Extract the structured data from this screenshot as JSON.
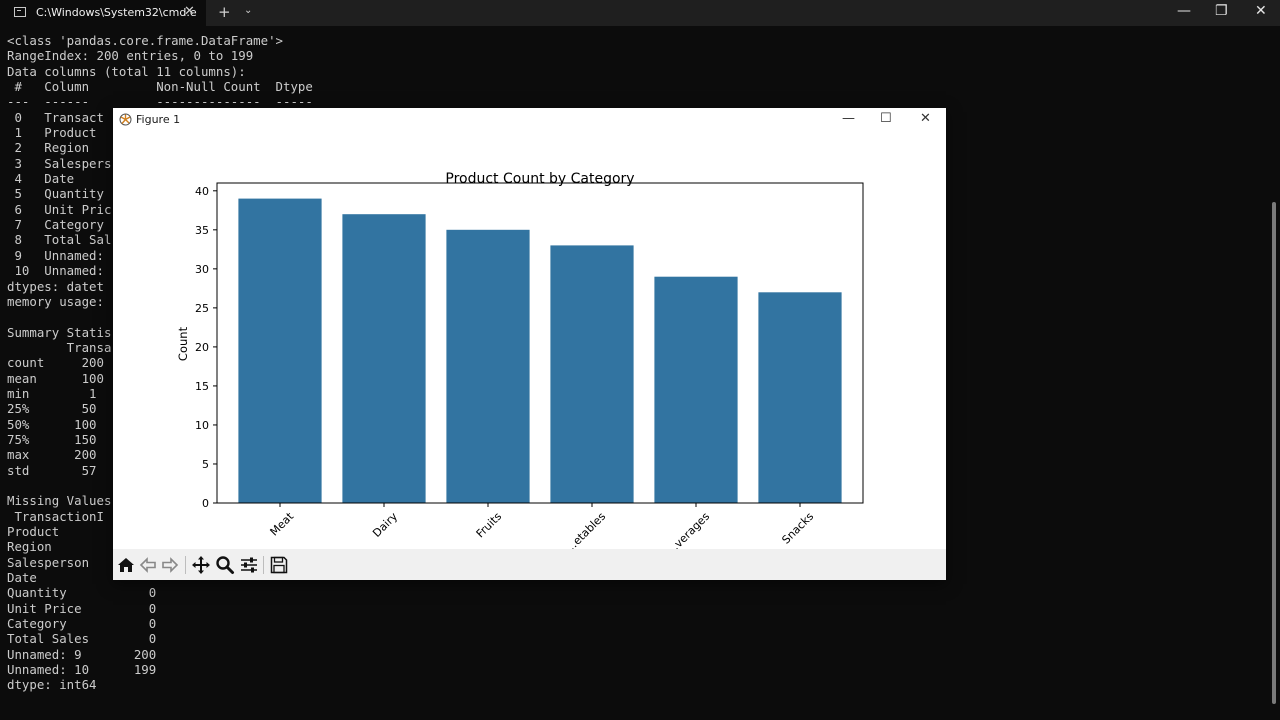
{
  "terminal": {
    "tab_title": "C:\\Windows\\System32\\cmd.e",
    "new_tab": "+",
    "lines": [
      "<class 'pandas.core.frame.DataFrame'>",
      "RangeIndex: 200 entries, 0 to 199",
      "Data columns (total 11 columns):",
      " #   Column         Non-Null Count  Dtype",
      "---  ------         --------------  -----",
      " 0   Transact",
      " 1   Product",
      " 2   Region",
      " 3   Salespers",
      " 4   Date",
      " 5   Quantity",
      " 6   Unit Pric",
      " 7   Category",
      " 8   Total Sal",
      " 9   Unnamed:",
      " 10  Unnamed:",
      "dtypes: datet",
      "memory usage:",
      "",
      "Summary Statis",
      "        Transa",
      "count     200",
      "mean      100",
      "min        1",
      "25%       50",
      "50%      100",
      "75%      150",
      "max      200",
      "std       57",
      "",
      "Missing Values",
      " TransactionI",
      "Product",
      "Region",
      "Salesperson",
      "Date",
      "Quantity           0",
      "Unit Price         0",
      "Category           0",
      "Total Sales        0",
      "Unnamed: 9       200",
      "Unnamed: 10      199",
      "dtype: int64"
    ]
  },
  "figure": {
    "window_title": "Figure 1",
    "toolbar": [
      "home-icon",
      "back-icon",
      "forward-icon",
      "pan-icon",
      "zoom-icon",
      "configure-icon",
      "save-icon"
    ]
  },
  "chart_data": {
    "type": "bar",
    "title": "Product Count by Category",
    "xlabel": "",
    "ylabel": "Count",
    "categories": [
      "Meat",
      "Dairy",
      "Fruits",
      "Vegetables",
      "Beverages",
      "Snacks"
    ],
    "category_labels_visible": [
      "Meat",
      "Dairy",
      "Fruits",
      "…etables",
      "…verages",
      "Snacks"
    ],
    "values": [
      39,
      37,
      35,
      33,
      29,
      27
    ],
    "ylim": [
      0,
      41
    ],
    "yticks": [
      0,
      5,
      10,
      15,
      20,
      25,
      30,
      35,
      40
    ],
    "bar_color": "#3274a1",
    "grid": false,
    "legend": "none"
  }
}
